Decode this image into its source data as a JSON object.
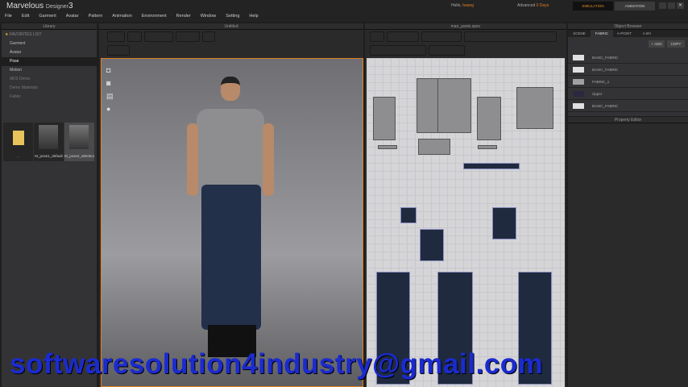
{
  "app": {
    "title": "Marvelous",
    "subtitle": "Designer",
    "version": "3"
  },
  "menu": [
    "File",
    "Edit",
    "Garment",
    "Avatar",
    "Pattern",
    "Animation",
    "Environment",
    "Render",
    "Window",
    "Setting",
    "Help"
  ],
  "user": {
    "hello": "Hello,",
    "name": "baang",
    "license": "Advanced",
    "days": "0 Days"
  },
  "modes": {
    "simulation": "SIMULATION",
    "animation": "ANIMATION"
  },
  "library": {
    "header": "Library",
    "favorites": "FAVORITES LIST",
    "items": [
      "Garment",
      "Avatar",
      "Pose",
      "Motion",
      "MD3 Demo",
      "Demo Materials",
      "Fabric"
    ],
    "selected": "Pose",
    "thumbs": [
      "..",
      "M_pose1_default",
      "M_pose2_attention"
    ]
  },
  "view3d": {
    "header": "Untitled"
  },
  "view2d": {
    "header": "man_pants.spec"
  },
  "object_browser": {
    "header": "Object Browser",
    "tabs": [
      "SCENE",
      "FABRIC",
      "A-POINT",
      "A-BV"
    ],
    "active_tab": "FABRIC",
    "add": "ADD",
    "copy": "COPY",
    "fabrics": [
      {
        "name": "BASIC_FABRIC",
        "color": "#e0e0e0"
      },
      {
        "name": "BASIC_FABRIC",
        "color": "#e0e0e0"
      },
      {
        "name": "FABRIC_1",
        "color": "#a0a0a0"
      },
      {
        "name": "zipper",
        "color": "#2a2840"
      },
      {
        "name": "BASIC_FABRIC",
        "color": "#e0e0e0"
      }
    ]
  },
  "property_editor": {
    "header": "Property Editor"
  },
  "watermark": "softwaresolution4industry@gmail.com"
}
